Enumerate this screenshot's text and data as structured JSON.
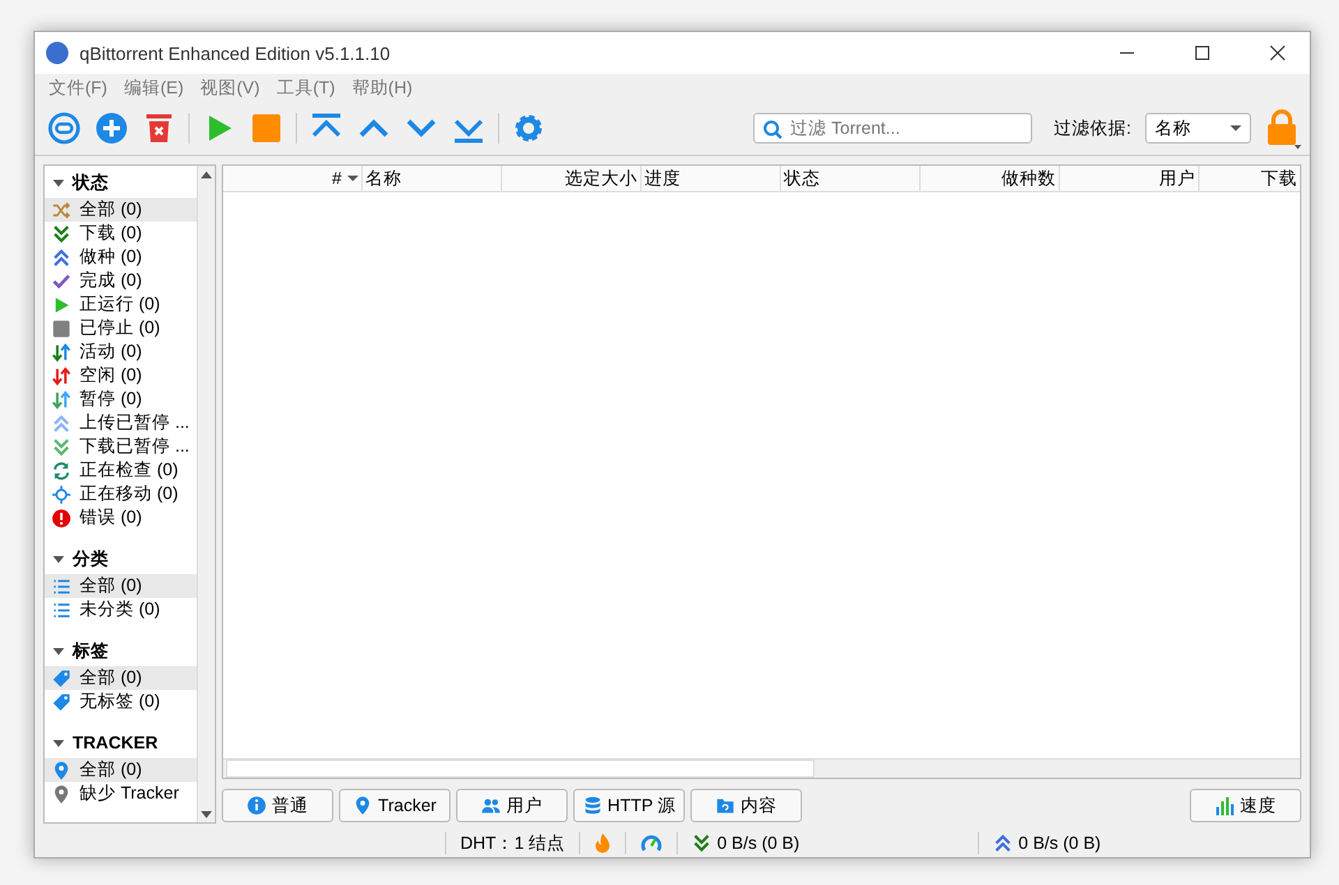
{
  "window": {
    "title": "qBittorrent Enhanced Edition v5.1.1.10"
  },
  "menu": [
    "文件(F)",
    "编辑(E)",
    "视图(V)",
    "工具(T)",
    "帮助(H)"
  ],
  "search": {
    "placeholder": "过滤 Torrent..."
  },
  "filter": {
    "label": "过滤依据:",
    "value": "名称"
  },
  "sidebar": [
    {
      "title": "状态",
      "expanded": true,
      "items": [
        {
          "kind": "shuffle",
          "label": "全部 (0)",
          "selected": true
        },
        {
          "kind": "down",
          "label": "下载 (0)",
          "selected": false
        },
        {
          "kind": "up",
          "label": "做种 (0)",
          "selected": false
        },
        {
          "kind": "check",
          "label": "完成 (0)",
          "selected": false
        },
        {
          "kind": "play",
          "label": "正运行 (0)",
          "selected": false
        },
        {
          "kind": "stop",
          "label": "已停止 (0)",
          "selected": false
        },
        {
          "kind": "active",
          "label": "活动 (0)",
          "selected": false
        },
        {
          "kind": "idle",
          "label": "空闲 (0)",
          "selected": false
        },
        {
          "kind": "paused",
          "label": "暂停 (0)",
          "selected": false
        },
        {
          "kind": "up-paused",
          "label": "上传已暂停 ...",
          "selected": false
        },
        {
          "kind": "down-paused",
          "label": "下载已暂停 ...",
          "selected": false
        },
        {
          "kind": "checking",
          "label": "正在检查 (0)",
          "selected": false
        },
        {
          "kind": "moving",
          "label": "正在移动 (0)",
          "selected": false
        },
        {
          "kind": "error",
          "label": "错误 (0)",
          "selected": false
        }
      ]
    },
    {
      "title": "分类",
      "expanded": true,
      "items": [
        {
          "kind": "list",
          "label": "全部 (0)",
          "selected": true
        },
        {
          "kind": "list",
          "label": "未分类 (0)",
          "selected": false
        }
      ]
    },
    {
      "title": "标签",
      "expanded": true,
      "items": [
        {
          "kind": "tag",
          "label": "全部 (0)",
          "selected": true
        },
        {
          "kind": "tag",
          "label": "无标签 (0)",
          "selected": false
        }
      ]
    },
    {
      "title": "TRACKER",
      "expanded": true,
      "items": [
        {
          "kind": "pin",
          "label": "全部 (0)",
          "selected": true
        },
        {
          "kind": "pin-grey",
          "label": "缺少 Tracker",
          "selected": false
        }
      ]
    }
  ],
  "table": {
    "columns": [
      {
        "label": "#",
        "sorted": true
      },
      {
        "label": "名称",
        "sorted": false
      },
      {
        "label": "选定大小",
        "sorted": false
      },
      {
        "label": "进度",
        "sorted": false
      },
      {
        "label": "状态",
        "sorted": false
      },
      {
        "label": "做种数",
        "sorted": false
      },
      {
        "label": "用户",
        "sorted": false
      },
      {
        "label": "下载",
        "sorted": false
      }
    ]
  },
  "detail_tabs": [
    {
      "kind": "info",
      "label": "普通"
    },
    {
      "kind": "pin",
      "label": "Tracker"
    },
    {
      "kind": "users",
      "label": "用户"
    },
    {
      "kind": "db",
      "label": "HTTP 源"
    },
    {
      "kind": "folder",
      "label": "内容"
    }
  ],
  "speed_button": {
    "label": "速度"
  },
  "status_bar": {
    "dht": "DHT：1 结点",
    "download": "0 B/s (0 B)",
    "upload": "0 B/s (0 B)"
  }
}
